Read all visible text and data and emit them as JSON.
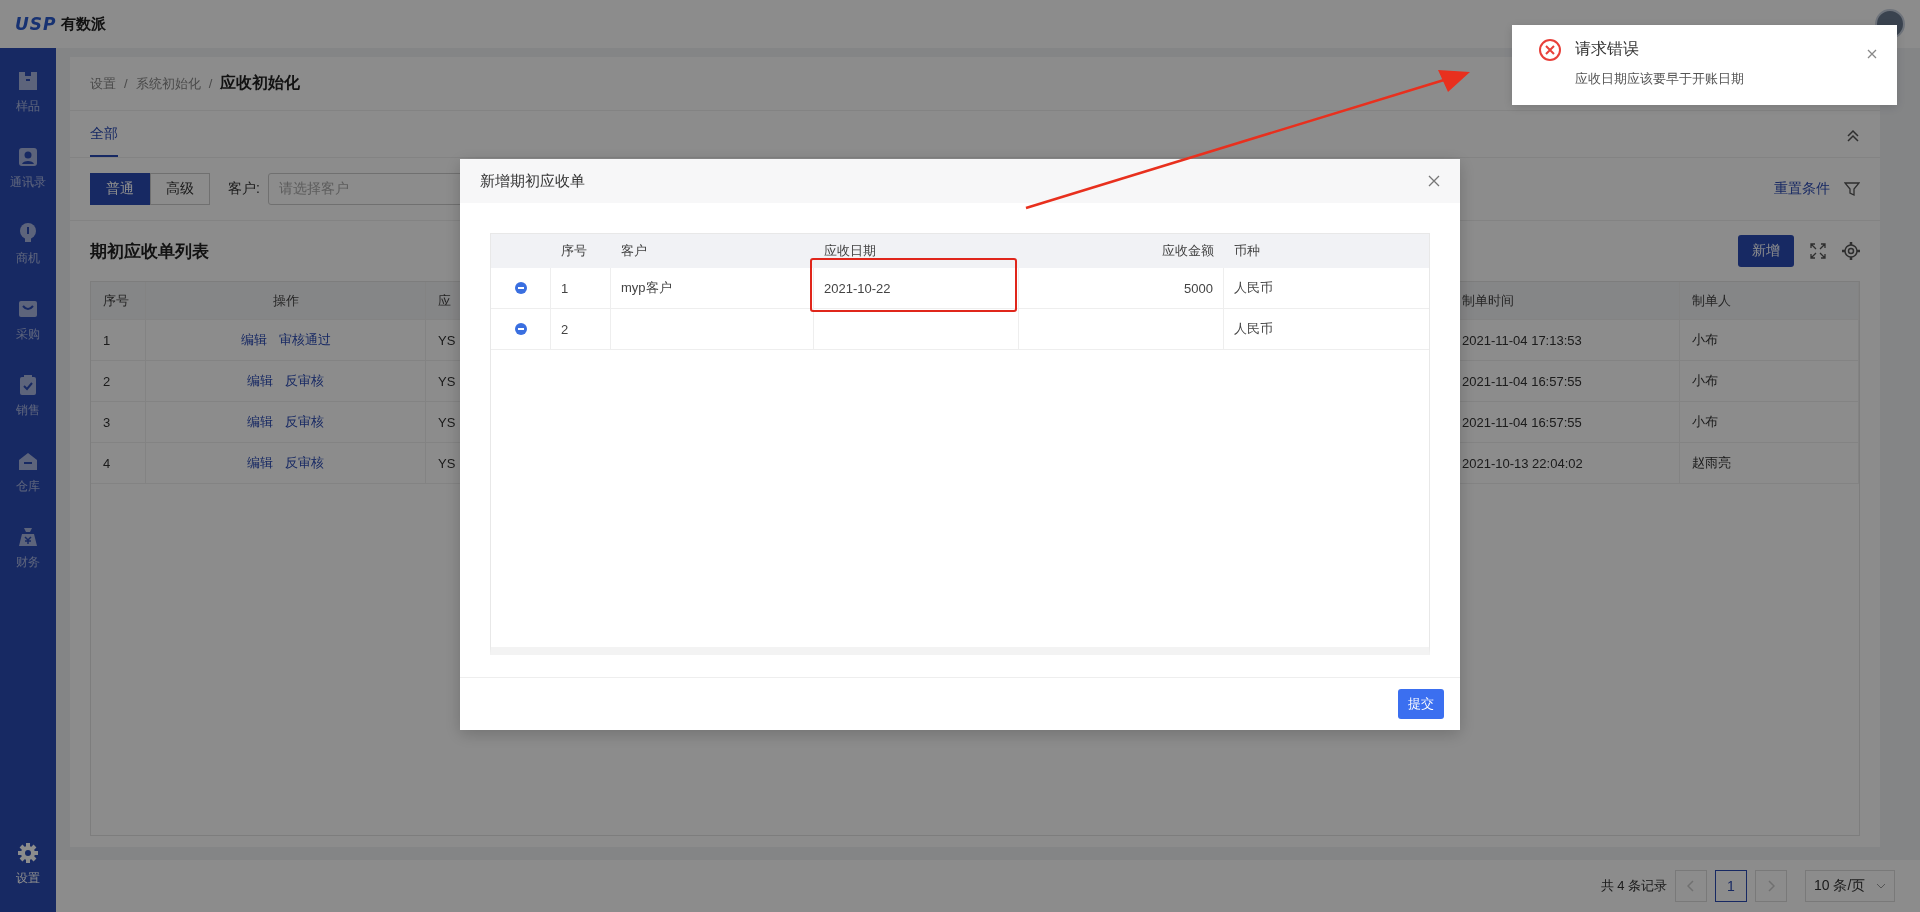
{
  "header": {
    "logo_mark": "USP",
    "logo_text": "有数派"
  },
  "sidebar": {
    "items": [
      {
        "label": "样品",
        "selected": false
      },
      {
        "label": "通讯录",
        "selected": false
      },
      {
        "label": "商机",
        "selected": false
      },
      {
        "label": "采购",
        "selected": false
      },
      {
        "label": "销售",
        "selected": false
      },
      {
        "label": "仓库",
        "selected": false
      },
      {
        "label": "财务",
        "selected": false
      },
      {
        "label": "设置",
        "selected": true
      }
    ]
  },
  "breadcrumb": [
    {
      "label": "设置",
      "separator": "/",
      "current": false
    },
    {
      "label": "系统初始化",
      "separator": "/",
      "current": false
    },
    {
      "label": "应收初始化",
      "current": true
    }
  ],
  "tabs": [
    {
      "label": "全部",
      "selected": true
    }
  ],
  "filter": {
    "modes": [
      {
        "label": "普通",
        "selected": true
      },
      {
        "label": "高级",
        "selected": false
      }
    ],
    "customer_label": "客户:",
    "customer_placeholder": "请选择客户",
    "reset": "重置条件"
  },
  "list": {
    "title": "期初应收单列表",
    "add_button": "新增",
    "columns": [
      "序号",
      "操作",
      "应",
      "制单时间",
      "制单人"
    ],
    "rows": [
      {
        "no": "1",
        "actions": [
          "编辑",
          "审核通过"
        ],
        "column_3": "YS",
        "time": "2021-11-04 17:13:53",
        "maker": "小布"
      },
      {
        "no": "2",
        "actions": [
          "编辑",
          "反审核"
        ],
        "column_3": "YS",
        "time": "2021-11-04 16:57:55",
        "maker": "小布"
      },
      {
        "no": "3",
        "actions": [
          "编辑",
          "反审核"
        ],
        "column_3": "YS",
        "time": "2021-11-04 16:57:55",
        "maker": "小布"
      },
      {
        "no": "4",
        "actions": [
          "编辑",
          "反审核"
        ],
        "column_3": "YS",
        "time": "2021-10-13 22:04:02",
        "maker": "赵雨亮"
      }
    ]
  },
  "pagination": {
    "total": "共 4 条记录",
    "pages": [
      {
        "label": "1",
        "selected": true
      }
    ],
    "page_size": "10 条/页"
  },
  "modal": {
    "title": "新增期初应收单",
    "columns": [
      "序号",
      "客户",
      "应收日期",
      "应收金额",
      "币种"
    ],
    "rows": [
      {
        "no": "1",
        "customer": "myp客户",
        "date": "2021-10-22",
        "amount": "5000",
        "currency": "人民币"
      },
      {
        "no": "2",
        "currency": "人民币"
      }
    ],
    "submit": "提交"
  },
  "toast": {
    "title": "请求错误",
    "message": "应收日期应该要早于开账日期"
  }
}
